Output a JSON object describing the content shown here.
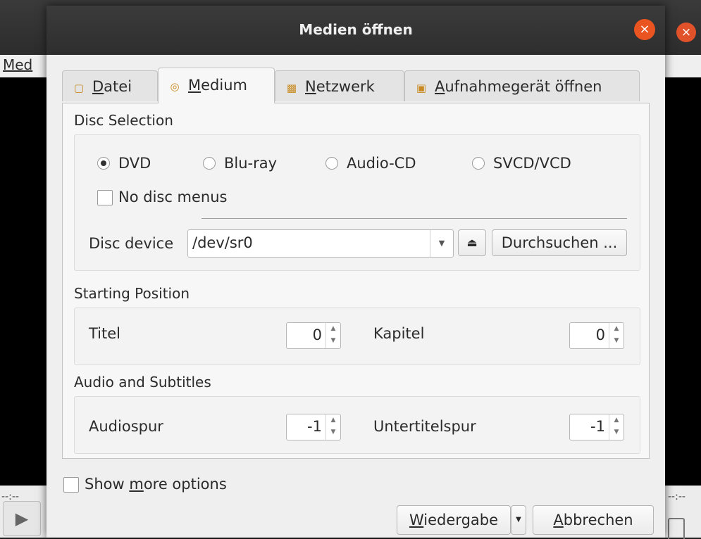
{
  "background": {
    "menu_label": "Med",
    "time_left": "--:--",
    "time_right": "--:--",
    "close_glyph": "×"
  },
  "dialog": {
    "title": "Medien öffnen",
    "close_glyph": "×"
  },
  "tabs": [
    {
      "label": "Datei",
      "mnemonic": "D",
      "icon": "file-icon",
      "active": false
    },
    {
      "label": "Medium",
      "mnemonic": "M",
      "icon": "disc-icon",
      "active": true
    },
    {
      "label": "Netzwerk",
      "mnemonic": "N",
      "icon": "network-icon",
      "active": false
    },
    {
      "label": "Aufnahmegerät öffnen",
      "mnemonic": "A",
      "icon": "capture-device-icon",
      "active": false
    }
  ],
  "disc_selection": {
    "heading": "Disc Selection",
    "options": [
      {
        "label": "DVD",
        "selected": true
      },
      {
        "label": "Blu-ray",
        "selected": false
      },
      {
        "label": "Audio-CD",
        "selected": false
      },
      {
        "label": "SVCD/VCD",
        "selected": false
      }
    ],
    "no_disc_menus": {
      "label": "No disc menus",
      "checked": false
    },
    "device_label": "Disc device",
    "device_value": "/dev/sr0",
    "eject_glyph": "⏏",
    "browse_label": "Durchsuchen ..."
  },
  "starting_position": {
    "heading": "Starting Position",
    "title_label": "Titel",
    "title_value": "0",
    "chapter_label": "Kapitel",
    "chapter_value": "0"
  },
  "audio_subtitles": {
    "heading": "Audio and Subtitles",
    "audio_label": "Audiospur",
    "audio_value": "-1",
    "subtitle_label": "Untertitelspur",
    "subtitle_value": "-1"
  },
  "footer": {
    "show_more_options": {
      "label_pre": "Show ",
      "label_mnemonic": "m",
      "label_post": "ore options",
      "checked": false
    },
    "play_button": {
      "mnemonic": "W",
      "rest": "iedergabe"
    },
    "cancel_button": {
      "mnemonic": "A",
      "rest": "bbrechen"
    }
  },
  "colors": {
    "close_button": "#e95420",
    "dialog_bg": "#efefef",
    "titlebar": "#2e2e2e"
  }
}
